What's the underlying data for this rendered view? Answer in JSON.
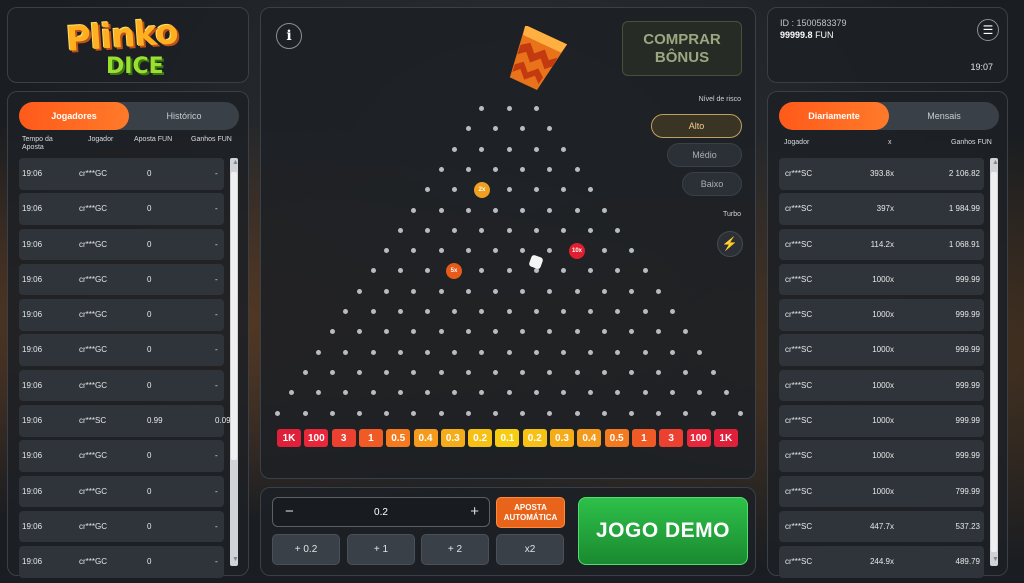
{
  "logo": {
    "line1": "Plinko",
    "line2": "DICE"
  },
  "left": {
    "tabs": [
      "Jogadores",
      "Histórico"
    ],
    "headers": [
      "Tempo da Aposta",
      "Jogador",
      "Aposta FUN",
      "Ganhos FUN"
    ],
    "rows": [
      [
        "19:06",
        "cr***GC",
        "0",
        "-"
      ],
      [
        "19:06",
        "cr***GC",
        "0",
        "-"
      ],
      [
        "19:06",
        "cr***GC",
        "0",
        "-"
      ],
      [
        "19:06",
        "cr***GC",
        "0",
        "-"
      ],
      [
        "19:06",
        "cr***GC",
        "0",
        "-"
      ],
      [
        "19:06",
        "cr***GC",
        "0",
        "-"
      ],
      [
        "19:06",
        "cr***GC",
        "0",
        "-"
      ],
      [
        "19:06",
        "cr***SC",
        "0.99",
        "0.09"
      ],
      [
        "19:06",
        "cr***GC",
        "0",
        "-"
      ],
      [
        "19:06",
        "cr***GC",
        "0",
        "-"
      ],
      [
        "19:06",
        "cr***GC",
        "0",
        "-"
      ],
      [
        "19:06",
        "cr***GC",
        "0",
        "-"
      ]
    ]
  },
  "board": {
    "info": "i",
    "bonus": "COMPRAR BÔNUS",
    "risk_label": "Nível de risco",
    "risk": [
      "Alto",
      "Médio",
      "Baixo"
    ],
    "turbo_label": "Turbo",
    "ball_mults": [
      "2x",
      "10x",
      "5x"
    ],
    "slots": [
      "1K",
      "100",
      "3",
      "1",
      "0.5",
      "0.4",
      "0.3",
      "0.2",
      "0.1",
      "0.2",
      "0.3",
      "0.4",
      "0.5",
      "1",
      "3",
      "100",
      "1K"
    ]
  },
  "controls": {
    "minus": "−",
    "bet": "0.2",
    "plus": "+",
    "auto": "APOSTA AUTOMÁTICA",
    "play": "JOGO DEMO",
    "quick": [
      "+ 0.2",
      "+ 1",
      "+ 2",
      "x2"
    ]
  },
  "account": {
    "id": "ID : 1500583379",
    "balance": "99999.8",
    "currency": "FUN",
    "time": "19:07"
  },
  "right": {
    "tabs": [
      "Diariamente",
      "Mensais"
    ],
    "headers": [
      "Jogador",
      "x",
      "Ganhos FUN"
    ],
    "rows": [
      [
        "cr***SC",
        "393.8x",
        "2 106.82"
      ],
      [
        "cr***SC",
        "397x",
        "1 984.99"
      ],
      [
        "cr***SC",
        "114.2x",
        "1 068.91"
      ],
      [
        "cr***SC",
        "1000x",
        "999.99"
      ],
      [
        "cr***SC",
        "1000x",
        "999.99"
      ],
      [
        "cr***SC",
        "1000x",
        "999.99"
      ],
      [
        "cr***SC",
        "1000x",
        "999.99"
      ],
      [
        "cr***SC",
        "1000x",
        "999.99"
      ],
      [
        "cr***SC",
        "1000x",
        "999.99"
      ],
      [
        "cr***SC",
        "1000x",
        "799.99"
      ],
      [
        "cr***SC",
        "447.7x",
        "537.23"
      ],
      [
        "cr***SC",
        "244.9x",
        "489.79"
      ]
    ]
  }
}
